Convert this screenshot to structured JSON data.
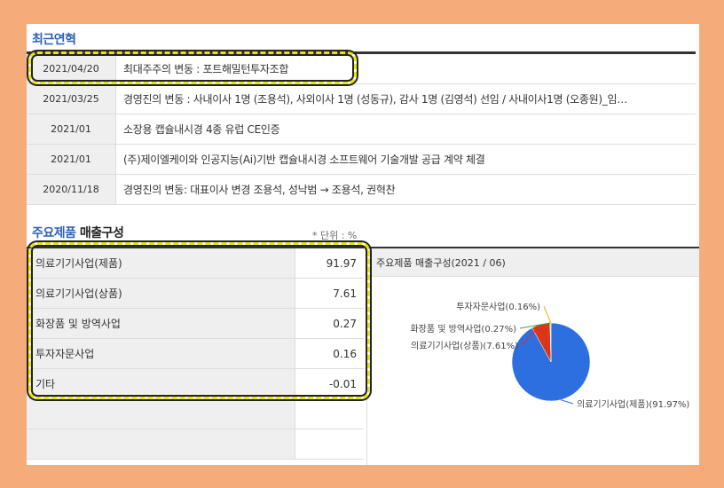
{
  "history": {
    "title": "최근연혁",
    "rows": [
      {
        "date": "2021/04/20",
        "text": "최대주주의 변동 : 포트해밀턴투자조합"
      },
      {
        "date": "2021/03/25",
        "text": "경영진의 변동 : 사내이사 1명 (조용석), 사외이사 1명 (성동규), 감사 1명 (김영석) 선임 / 사내이사1명 (오종원)_임…"
      },
      {
        "date": "2021/01",
        "text": "소장용 캡슐내시경 4종 유럽 CE인증"
      },
      {
        "date": "2021/01",
        "text": "(주)제이엘케이와 인공지능(Ai)기반 캡슐내시경 소프트웨어 기술개발 공급 계약 체결"
      },
      {
        "date": "2020/11/18",
        "text": "경영진의 변동: 대표이사 변경 조용석, 성낙범 → 조용석, 권혁찬"
      }
    ]
  },
  "products": {
    "title_highlight": "주요제품",
    "title_rest": " 매출구성",
    "unit": "* 단위 : %",
    "rows": [
      {
        "name": "의료기기사업(제품)",
        "value": "91.97"
      },
      {
        "name": "의료기기사업(상품)",
        "value": "7.61"
      },
      {
        "name": "화장품 및 방역사업",
        "value": "0.27"
      },
      {
        "name": "투자자문사업",
        "value": "0.16"
      },
      {
        "name": "기타",
        "value": "-0.01"
      }
    ],
    "chart_title": "주요제품 매출구성(2021 / 06)"
  },
  "chart_data": {
    "type": "pie",
    "title": "주요제품 매출구성(2021 / 06)",
    "slices": [
      {
        "label": "의료기기사업(제품)(91.97%)",
        "value": 91.97,
        "color": "#2e6fe0"
      },
      {
        "label": "의료기기사업(상품)(7.61%)",
        "value": 7.61,
        "color": "#d9361a"
      },
      {
        "label": "화장품 및 방역사업(0.27%)",
        "value": 0.27,
        "color": "#3aa33a"
      },
      {
        "label": "투자자문사업(0.16%)",
        "value": 0.16,
        "color": "#e8b21a"
      }
    ]
  },
  "colors": {
    "accent": "#2d61b8",
    "highlight": "#e8e600",
    "background": "#f4ad7a"
  }
}
